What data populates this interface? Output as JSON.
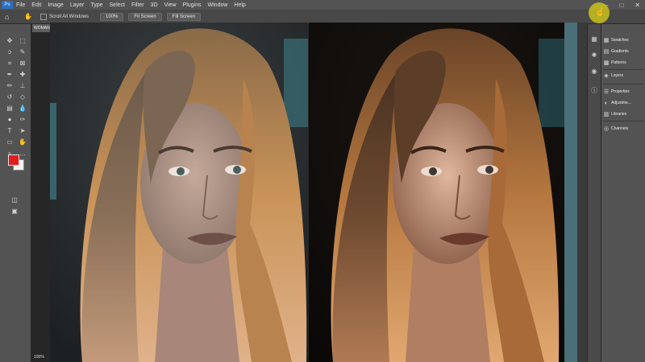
{
  "app": {
    "logo": "Ps"
  },
  "menu": [
    "File",
    "Edit",
    "Image",
    "Layer",
    "Type",
    "Select",
    "Filter",
    "3D",
    "View",
    "Plugins",
    "Window",
    "Help"
  ],
  "window_controls": {
    "minimize": "—",
    "maximize": "□",
    "close": "✕"
  },
  "options_bar": {
    "scroll_all_windows": "Scroll All Windows",
    "zoom_value": "100%",
    "fit_screen_1": "Fit Screen",
    "fit_screen_2": "Fill Screen"
  },
  "document_tab": {
    "label": "WOMAN"
  },
  "status_bar": {
    "zoom": "100%"
  },
  "panels": {
    "swatches": "Swatches",
    "gradients": "Gradients",
    "patterns": "Patterns",
    "layers": "Layers",
    "properties": "Properties",
    "adjustments": "Adjustme...",
    "libraries": "Libraries",
    "channels": "Channels"
  },
  "colors": {
    "foreground": "#e21d1d",
    "background": "#f2f2f2",
    "cursor_highlight": "#c9c21c"
  },
  "tools": [
    "move-tool",
    "marquee-tool",
    "lasso-tool",
    "quick-select-tool",
    "crop-tool",
    "frame-tool",
    "eyedropper-tool",
    "healing-tool",
    "brush-tool",
    "stamp-tool",
    "history-brush-tool",
    "eraser-tool",
    "gradient-tool",
    "blur-tool",
    "dodge-tool",
    "pen-tool",
    "type-tool",
    "path-select-tool",
    "shape-tool",
    "hand-tool",
    "zoom-tool",
    "more-tools"
  ]
}
